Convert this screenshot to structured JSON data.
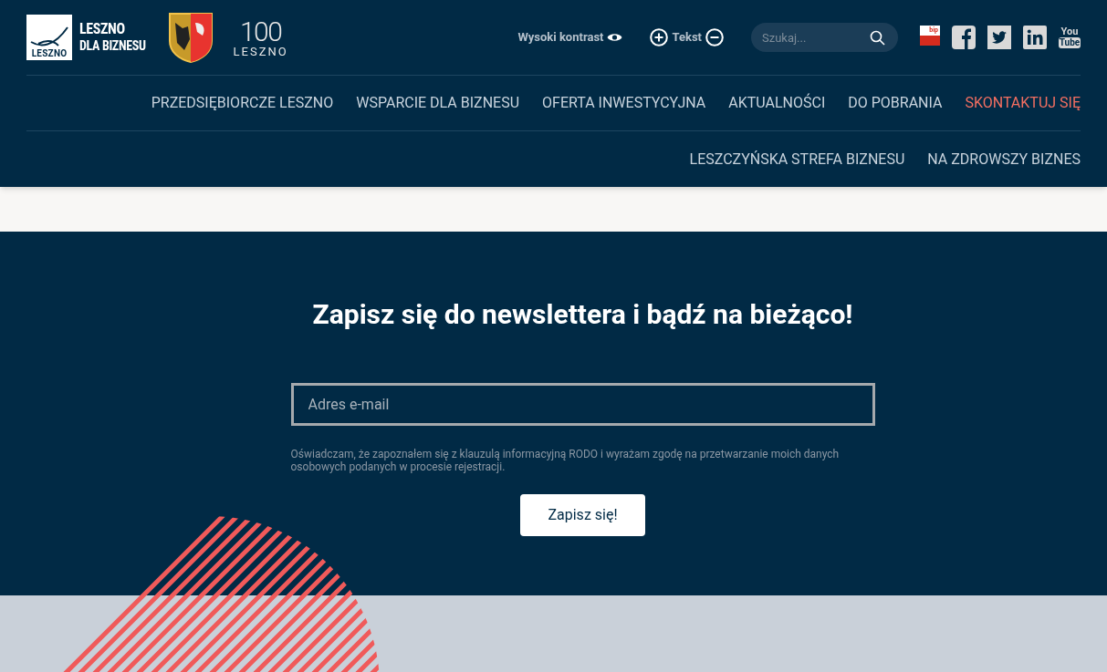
{
  "logos": {
    "main": {
      "line1": "LESZNO",
      "line2": "DLA BIZNESU",
      "mark_word": "LESZNO"
    },
    "anniversary": {
      "number": "100",
      "word": "LESZNO"
    }
  },
  "toolbar": {
    "contrast": "Wysoki kontrast",
    "text_size": "Tekst",
    "search": {
      "placeholder": "Szukaj..."
    }
  },
  "social": [
    {
      "kind": "bip",
      "label": "bip"
    },
    {
      "kind": "facebook"
    },
    {
      "kind": "twitter"
    },
    {
      "kind": "linkedin"
    },
    {
      "kind": "youtube",
      "label": "You",
      "label2": "Tube"
    }
  ],
  "nav_rows": [
    [
      {
        "label": "PRZEDSIĘBIORCZE LESZNO",
        "selected": false
      },
      {
        "label": "WSPARCIE DLA BIZNESU",
        "selected": false
      },
      {
        "label": "OFERTA INWESTYCYJNA",
        "selected": false
      },
      {
        "label": "AKTUALNOŚCI",
        "selected": false
      },
      {
        "label": "DO POBRANIA",
        "selected": false
      },
      {
        "label": "SKONTAKTUJ SIĘ",
        "selected": true
      }
    ],
    [
      {
        "label": "LESZCZYŃSKA STREFA BIZNESU",
        "selected": false
      },
      {
        "label": "NA ZDROWSZY BIZNES",
        "selected": false
      }
    ]
  ],
  "newsletter": {
    "title": "Zapisz się do newslettera i bądź na bieżąco!",
    "email": {
      "placeholder": "Adres e-mail"
    },
    "consent": "Oświadczam, że zapoznałem się z klauzulą informacyjną RODO i wyrażam zgodę na przetwarzanie moich danych osobowych podanych w procesie rejestracji.",
    "button": "Zapisz się!"
  }
}
